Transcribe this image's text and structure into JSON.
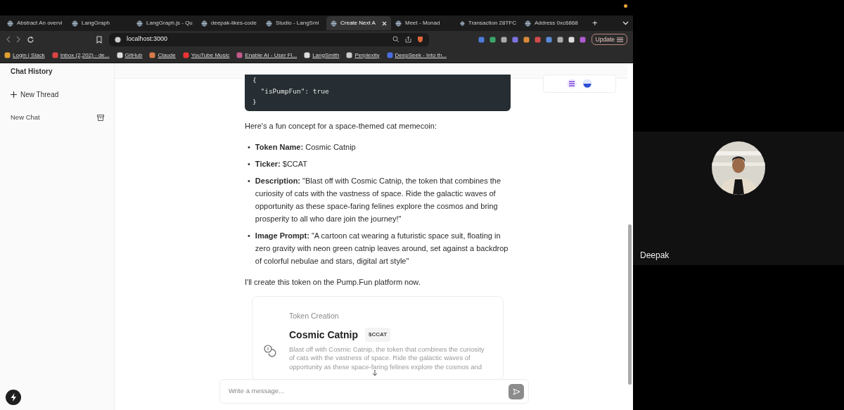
{
  "browser": {
    "tabs": [
      {
        "title": "Abstract An overvi",
        "selected": false
      },
      {
        "title": "LangGraph",
        "selected": false
      },
      {
        "title": "LangGraph.js - Qu",
        "selected": false
      },
      {
        "title": "deepak-likes-code",
        "selected": false
      },
      {
        "title": "Studio - LangSmi",
        "selected": false
      },
      {
        "title": "Create Next A",
        "selected": true
      },
      {
        "title": "Meet - Monad",
        "selected": false
      },
      {
        "title": "Transaction 28TFC",
        "selected": false
      },
      {
        "title": "Address 0xc6868",
        "selected": false
      }
    ],
    "new_tab": "+",
    "address": "localhost:3000",
    "update_button": "Update",
    "bookmarks": [
      "Login | Slack",
      "Inbox (2,202) - de...",
      "GitHub",
      "Claude",
      "YouTube Music",
      "Enable AI - User Fl...",
      "LangSmith",
      "Perplexity",
      "DeepSeek - Into th..."
    ]
  },
  "sidebar": {
    "title": "Chat History",
    "new_thread": "New Thread",
    "chats": [
      {
        "title": "New Chat"
      }
    ]
  },
  "chat": {
    "code_lines": [
      "{",
      "  \"isPumpFun\": true",
      "}"
    ],
    "intro": "Here's a fun concept for a space-themed cat memecoin:",
    "items": [
      {
        "marker": "•",
        "label": "Token Name:",
        "text": "Cosmic Catnip"
      },
      {
        "marker": "•",
        "label": "Ticker:",
        "text": "$CCAT"
      },
      {
        "marker": "•",
        "label": "Description:",
        "text": "\"Blast off with Cosmic Catnip, the token that combines the curiosity of cats with the vastness of space. Ride the galactic waves of opportunity as these space-faring felines explore the cosmos and bring prosperity to all who dare join the journey!\""
      },
      {
        "marker": "•",
        "label": "Image Prompt:",
        "text": "\"A cartoon cat wearing a futuristic space suit, floating in zero gravity with neon green catnip leaves around, set against a backdrop of colorful nebulae and stars, digital art style\""
      }
    ],
    "outro": "I'll create this token on the Pump.Fun platform now.",
    "tool_card": {
      "heading": "Token Creation",
      "name": "Cosmic Catnip",
      "symbol": "$CCAT",
      "description": "Blast off with Cosmic Catnip, the token that combines the curiosity of cats with the vastness of space. Ride the galactic waves of opportunity as these space-faring felines explore the cosmos and"
    },
    "input": {
      "placeholder": "Write a message..."
    }
  },
  "call": {
    "participant": "Deepak"
  }
}
